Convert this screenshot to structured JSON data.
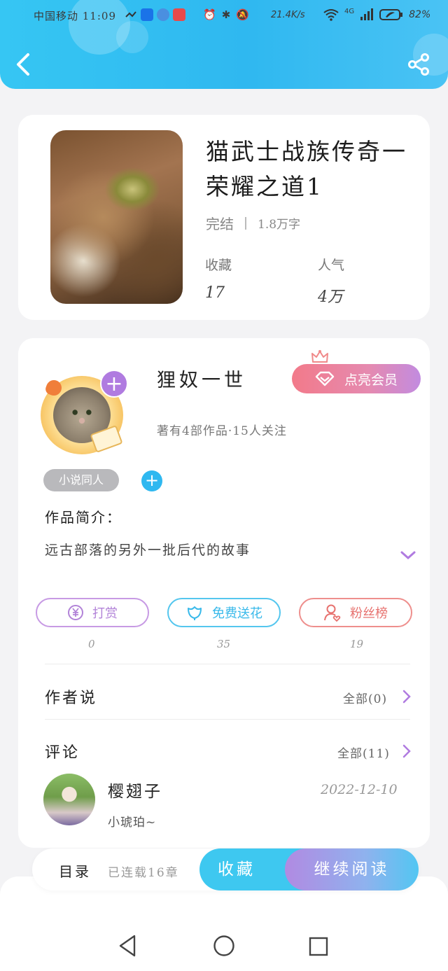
{
  "status_bar": {
    "carrier_time": "中国移动 11:09",
    "net_speed": "21.4K/s",
    "network": "4G",
    "battery": "82%"
  },
  "header": {
    "back_icon": "chevron-left-icon",
    "share_icon": "share-icon",
    "colors": {
      "gradient_start": "#36c6f3",
      "gradient_end": "#4ac3f4"
    }
  },
  "book": {
    "title": "猫武士战族传奇一荣耀之道1",
    "status": "完结",
    "word_count": "1.8万字",
    "favorites_label": "收藏",
    "favorites_value": "17",
    "popularity_label": "人气",
    "popularity_value": "4万"
  },
  "author": {
    "name": "狸奴一世",
    "summary": "著有4部作品·15人关注",
    "vip_button": "点亮会员",
    "tag": "小说同人",
    "intro_label": "作品简介：",
    "intro_text": "远古部落的另外一批后代的故事"
  },
  "actions": [
    {
      "label": "打赏",
      "count": "0",
      "icon": "yen-icon"
    },
    {
      "label": "免费送花",
      "count": "35",
      "icon": "flower-icon"
    },
    {
      "label": "粉丝榜",
      "count": "19",
      "icon": "fan-ranking-icon"
    }
  ],
  "author_says": {
    "label": "作者说",
    "link": "全部(0)"
  },
  "comments": {
    "label": "评论",
    "link": "全部(11)",
    "items": [
      {
        "user": "樱翅子",
        "text": "小琥珀~",
        "date": "2022-12-10"
      }
    ]
  },
  "bottom_bar": {
    "toc": "目录",
    "serial": "已连载16章",
    "favorite": "收藏",
    "continue_reading": "继续阅读"
  },
  "colors": {
    "accent_blue": "#2fb8f0",
    "accent_purple": "#b07be0",
    "accent_pink": "#f27a8a"
  }
}
